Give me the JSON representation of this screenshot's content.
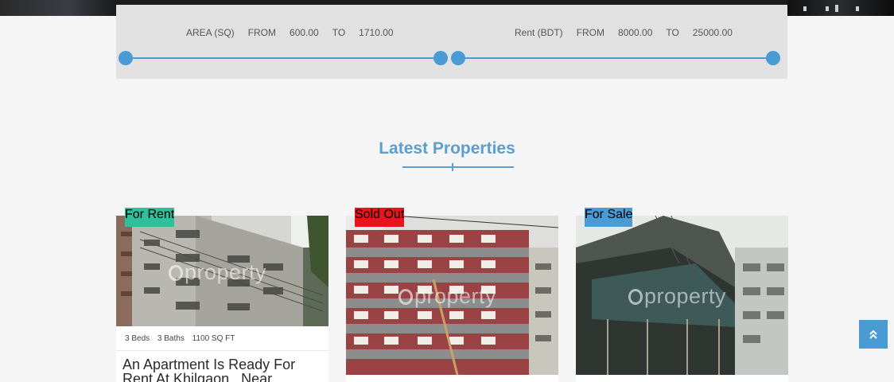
{
  "search": {
    "area": {
      "label": "AREA (SQ)",
      "from_label": "FROM",
      "from": "600.00",
      "to_label": "TO",
      "to": "1710.00"
    },
    "rent": {
      "label": "Rent (BDT)",
      "from_label": "FROM",
      "from": "8000.00",
      "to_label": "TO",
      "to": "25000.00"
    }
  },
  "section": {
    "title": "Latest Properties"
  },
  "watermark_text": "property",
  "cards": [
    {
      "badge": "For Rent",
      "badge_color": "#2fbf9a",
      "beds": "3 Beds",
      "baths": "3 Baths",
      "size": "1100 SQ FT",
      "title": "An Apartment Is Ready For Rent At Khilgaon , Near"
    },
    {
      "badge": "Sold Out",
      "badge_color": "#e8141c"
    },
    {
      "badge": "For Sale",
      "badge_color": "#4a9ad4"
    }
  ],
  "colors": {
    "accent": "#4a9ad4",
    "title": "#5a9fd0"
  },
  "icons": {
    "back_to_top": "double-chevron-up-icon"
  }
}
